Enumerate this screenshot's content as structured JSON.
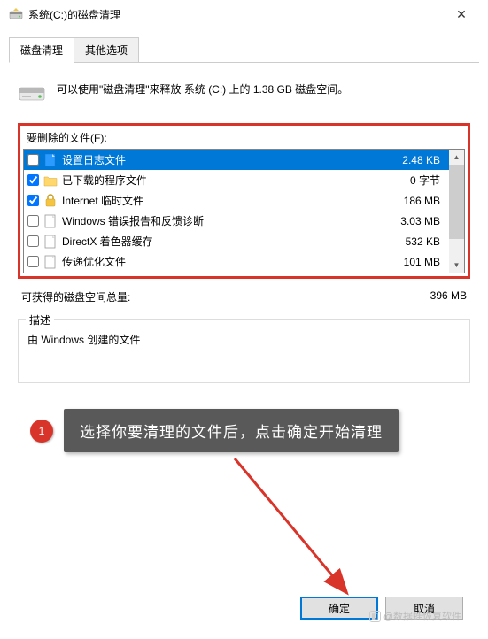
{
  "titlebar": {
    "title": "系统(C:)的磁盘清理",
    "close_glyph": "✕"
  },
  "tabs": [
    {
      "label": "磁盘清理",
      "active": true
    },
    {
      "label": "其他选项",
      "active": false
    }
  ],
  "info_text": "可以使用\"磁盘清理\"来释放 系统 (C:) 上的 1.38 GB 磁盘空间。",
  "files_label": "要删除的文件(F):",
  "file_list": [
    {
      "checked": false,
      "icon": "page-blue",
      "name": "设置日志文件",
      "size": "2.48 KB",
      "selected": true
    },
    {
      "checked": true,
      "icon": "folder",
      "name": "已下载的程序文件",
      "size": "0 字节",
      "selected": false
    },
    {
      "checked": true,
      "icon": "lock",
      "name": "Internet 临时文件",
      "size": "186 MB",
      "selected": false
    },
    {
      "checked": false,
      "icon": "page",
      "name": "Windows 错误报告和反馈诊断",
      "size": "3.03 MB",
      "selected": false
    },
    {
      "checked": false,
      "icon": "page",
      "name": "DirectX 着色器缓存",
      "size": "532 KB",
      "selected": false
    },
    {
      "checked": false,
      "icon": "page",
      "name": "传递优化文件",
      "size": "101 MB",
      "selected": false
    }
  ],
  "total": {
    "label": "可获得的磁盘空间总量:",
    "value": "396 MB"
  },
  "description": {
    "legend": "描述",
    "text": "由 Windows 创建的文件"
  },
  "annotation": {
    "number": "1",
    "text": "选择你要清理的文件后，点击确定开始清理"
  },
  "buttons": {
    "ok": "确定",
    "cancel": "取消"
  },
  "watermark": "@数据蛙恢复软件"
}
